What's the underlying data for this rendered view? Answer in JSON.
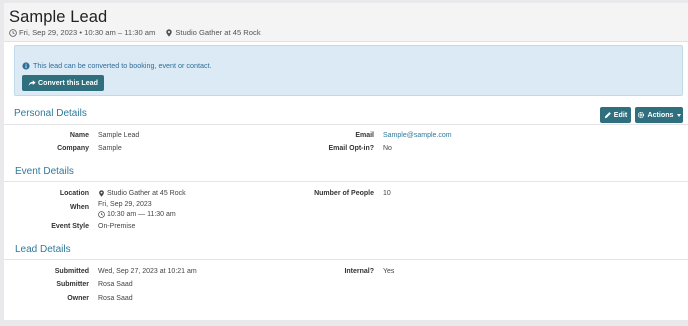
{
  "header": {
    "title": "Sample Lead",
    "datetime": "Fri, Sep 29, 2023 • 10:30 am – 11:30 am",
    "venue": "Studio Gather at 45 Rock"
  },
  "alert": {
    "message": "This lead can be converted to booking, event or contact.",
    "convert_label": "Convert this Lead"
  },
  "personal": {
    "title": "Personal Details",
    "edit_label": "Edit",
    "actions_label": "Actions",
    "name_label": "Name",
    "name_value": "Sample Lead",
    "company_label": "Company",
    "company_value": "Sample",
    "email_label": "Email",
    "email_value": "Sample@sample.com",
    "optin_label": "Email Opt-in?",
    "optin_value": "No"
  },
  "event": {
    "title": "Event Details",
    "location_label": "Location",
    "location_value": "Studio Gather at 45 Rock",
    "people_label": "Number of People",
    "people_value": "10",
    "when_label": "When",
    "when_date": "Fri, Sep 29, 2023",
    "when_time": "10:30 am — 11:30 am",
    "style_label": "Event Style",
    "style_value": "On-Premise"
  },
  "lead": {
    "title": "Lead Details",
    "submitted_label": "Submitted",
    "submitted_value": "Wed, Sep 27, 2023 at 10:21 am",
    "internal_label": "Internal?",
    "internal_value": "Yes",
    "submitter_label": "Submitter",
    "submitter_value": "Rosa Saad",
    "owner_label": "Owner",
    "owner_value": "Rosa Saad"
  },
  "colors": {
    "accent": "#2f6f7e",
    "link": "#2e7a9c",
    "alert_bg": "#dceaf5"
  },
  "icons": [
    "clock-icon",
    "map-pin-icon",
    "info-icon",
    "share-arrow-icon",
    "pencil-icon",
    "gear-icon",
    "caret-down-icon"
  ]
}
